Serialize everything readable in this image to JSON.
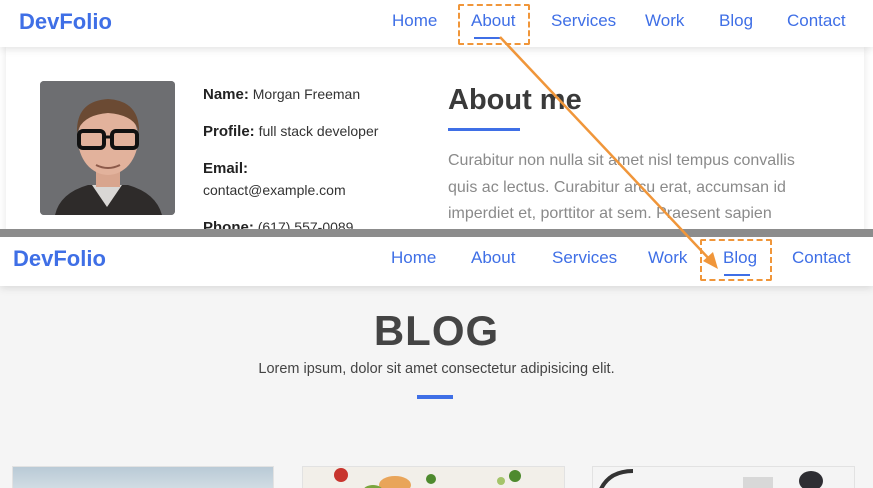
{
  "top_screen": {
    "brand": "DevFolio",
    "nav": [
      "Home",
      "About",
      "Services",
      "Work",
      "Blog",
      "Contact"
    ],
    "active_nav": "About",
    "profile": {
      "name_label": "Name:",
      "name_value": "Morgan Freeman",
      "profile_label": "Profile:",
      "profile_value": "full stack developer",
      "email_label": "Email:",
      "email_value": "contact@example.com",
      "phone_label": "Phone:",
      "phone_value": "(617) 557-0089"
    },
    "about_title": "About me",
    "about_lines": [
      "Curabitur non nulla sit amet nisl tempus convallis",
      "quis ac lectus. Curabitur arcu erat, accumsan id",
      "imperdiet et, porttitor at sem. Praesent sapien"
    ]
  },
  "bottom_screen": {
    "brand": "DevFolio",
    "nav": [
      "Home",
      "About",
      "Services",
      "Work",
      "Blog",
      "Contact"
    ],
    "active_nav": "Blog",
    "heading": "BLOG",
    "subtitle": "Lorem ipsum, dolor sit amet consectetur adipisicing elit."
  },
  "colors": {
    "accent": "#3f6fe6",
    "annotation": "#f0963a",
    "heading_text": "#444444",
    "body_text_muted": "#8a8a8a"
  },
  "annotation": {
    "type": "arrow",
    "from": "About",
    "to": "Blog"
  }
}
